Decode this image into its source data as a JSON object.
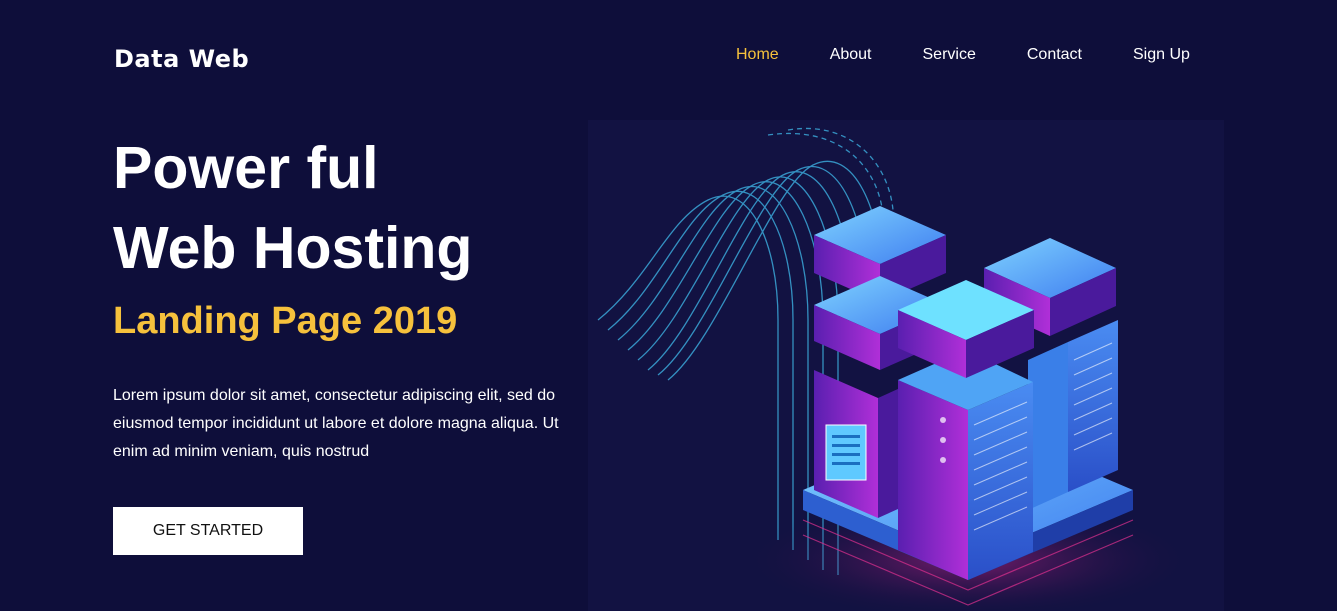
{
  "brand": {
    "logo_text": "Data Web"
  },
  "nav": {
    "items": [
      {
        "label": "Home",
        "active": true
      },
      {
        "label": "About",
        "active": false
      },
      {
        "label": "Service",
        "active": false
      },
      {
        "label": "Contact",
        "active": false
      },
      {
        "label": "Sign Up",
        "active": false
      }
    ]
  },
  "hero": {
    "title_line1": "Power ful",
    "title_line2": "Web Hosting",
    "subtitle": "Landing Page 2019",
    "description": "Lorem ipsum dolor sit amet, consectetur adipiscing elit, sed do eiusmod tempor incididunt ut labore et dolore magna aliqua. Ut enim ad minim veniam, quis nostrud",
    "cta_label": "GET STARTED"
  },
  "illustration": {
    "icon": "server-stack-illustration"
  },
  "colors": {
    "background": "#0e0e3a",
    "accent": "#f6c13c",
    "text": "#ffffff",
    "button_bg": "#ffffff"
  }
}
